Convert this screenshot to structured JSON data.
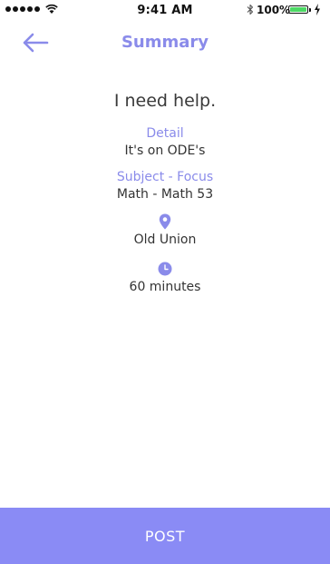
{
  "status_bar": {
    "time": "9:41 AM",
    "battery_percent": "100%"
  },
  "nav": {
    "title": "Summary",
    "back_icon": "arrow-left-icon"
  },
  "summary": {
    "headline": "I need help.",
    "detail_label": "Detail",
    "detail_value": "It's on ODE's",
    "subject_label": "Subject - Focus",
    "subject_value": "Math - Math 53",
    "location_icon": "location-pin-icon",
    "location_value": "Old Union",
    "duration_icon": "clock-icon",
    "duration_value": "60 minutes"
  },
  "actions": {
    "post_label": "POST"
  },
  "colors": {
    "accent": "#8a8bea",
    "button": "#8a8bf5",
    "battery_fill": "#4cd964"
  }
}
